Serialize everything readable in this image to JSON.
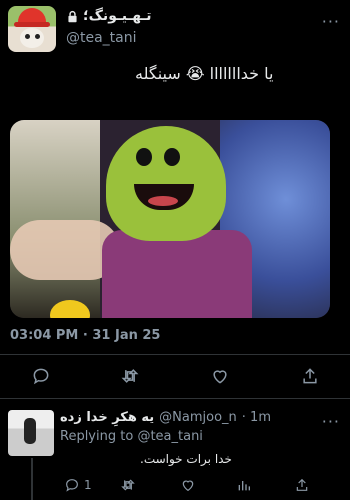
{
  "tweet": {
    "display_name": "تـهـیـونگ؛",
    "handle": "@tea_tani",
    "text": "یا خدااااااا 😭 سینگله",
    "timestamp": "03:04 PM · 31 Jan 25",
    "more_label": "···",
    "avatar_icon": "avatar-icon",
    "lock_icon": "lock-icon"
  },
  "actions": [
    {
      "name": "reply",
      "icon": "reply-icon"
    },
    {
      "name": "retweet",
      "icon": "retweet-icon"
    },
    {
      "name": "like",
      "icon": "like-icon"
    },
    {
      "name": "share",
      "icon": "share-icon"
    }
  ],
  "reply": {
    "display_name": "یه هکرِ خدا زده",
    "handle": "@Namjoo_n",
    "time": "· 1m",
    "replying_label": "Replying to",
    "replying_to": "@tea_tani",
    "text": "خدا برات خواست.",
    "more_label": "···",
    "reply_count": "1"
  },
  "colors": {
    "background": "#000000",
    "text": "#e7e9ea",
    "muted": "#8b98a5",
    "divider": "#2f3336"
  }
}
